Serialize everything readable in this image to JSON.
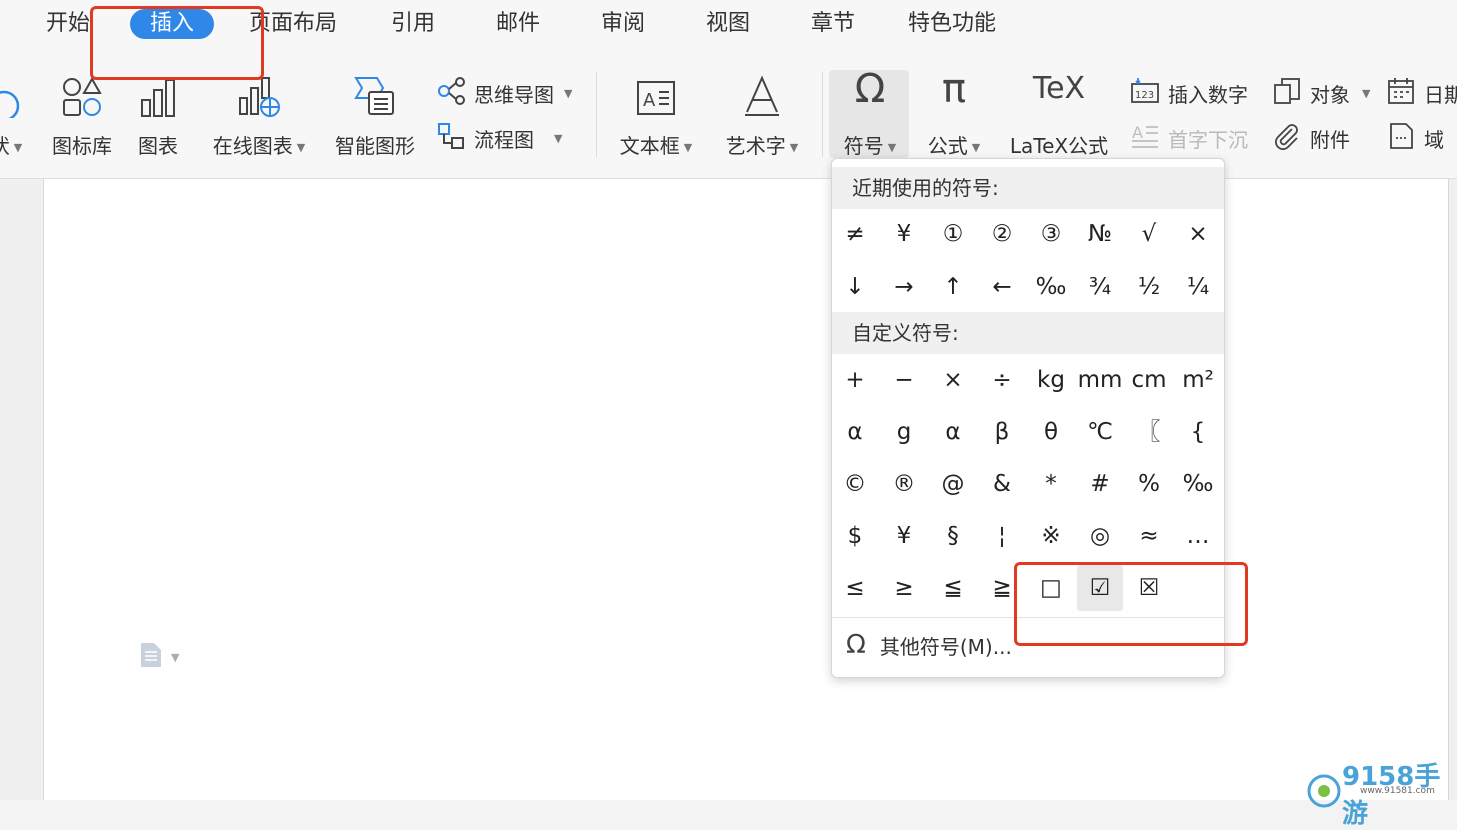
{
  "tabs": [
    "开始",
    "插入",
    "页面布局",
    "引用",
    "邮件",
    "审阅",
    "视图",
    "章节",
    "特色功能"
  ],
  "active_tab": "插入",
  "ribbon": {
    "shapes_partial": "状",
    "icon_library": "图标库",
    "chart": "图表",
    "online_chart": "在线图表",
    "smart_graphic": "智能图形",
    "mind_map": "思维导图",
    "flowchart": "流程图",
    "text_box": "文本框",
    "word_art": "艺术字",
    "symbol": "符号",
    "formula": "公式",
    "latex": "LaTeX公式",
    "insert_number": "插入数字",
    "drop_cap": "首字下沉",
    "object": "对象",
    "attachment": "附件",
    "date": "日期",
    "field": "域",
    "latex_icon_text": "TeX",
    "insert_number_icon_text": "123"
  },
  "symbol_menu": {
    "recent_title": "近期使用的符号:",
    "recent_symbols": [
      "≠",
      "¥",
      "①",
      "②",
      "③",
      "№",
      "√",
      "×",
      "↓",
      "→",
      "↑",
      "←",
      "‰",
      "¾",
      "½",
      "¼"
    ],
    "custom_title": "自定义符号:",
    "custom_symbols": [
      "+",
      "−",
      "×",
      "÷",
      "kg",
      "mm",
      "cm",
      "m²",
      "α",
      "g",
      "α",
      "β",
      "θ",
      "℃",
      "〖",
      "{",
      "©",
      "®",
      "@",
      "&",
      "*",
      "#",
      "%",
      "‰",
      "$",
      "¥",
      "§",
      "¦",
      "※",
      "◎",
      "≈",
      "…",
      "≤",
      "≥",
      "≦",
      "≧",
      "□",
      "☑",
      "☒"
    ],
    "more_symbols": "其他符号(M)..."
  },
  "watermark": {
    "text": "9158手游",
    "url": "www.91581.com"
  },
  "colors": {
    "accent": "#2f88e8",
    "highlight_red": "#e03a22"
  }
}
